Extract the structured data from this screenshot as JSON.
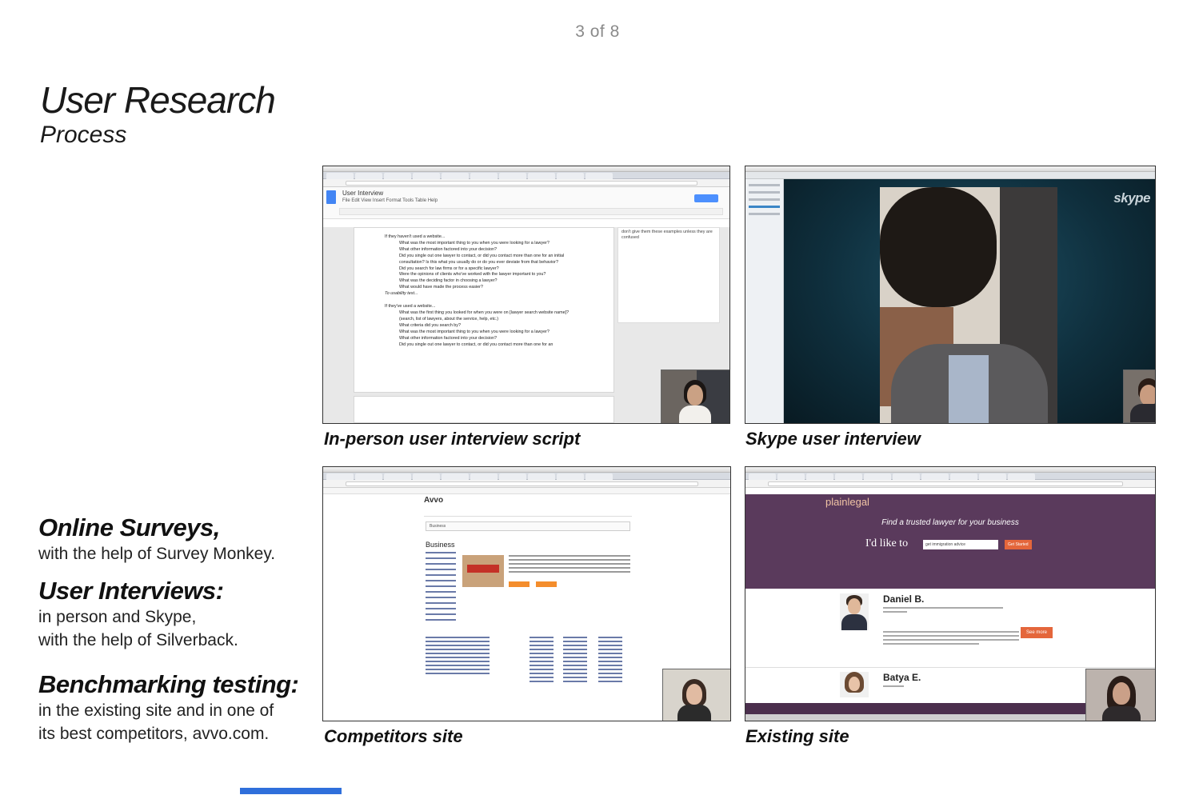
{
  "page_counter": "3 of 8",
  "title": "User Research",
  "subtitle": "Process",
  "methods": [
    {
      "heading": "Online Surveys,",
      "lines": [
        "with the help of Survey Monkey."
      ]
    },
    {
      "heading": "User Interviews:",
      "lines": [
        "in person and Skype,",
        "with the help of Silverback."
      ]
    },
    {
      "heading": "Benchmarking testing:",
      "lines": [
        "in the existing site and in one of",
        "its best competitors, avvo.com."
      ]
    }
  ],
  "screenshots": {
    "docs": {
      "caption": "In-person user interview script",
      "doc_title": "User Interview",
      "menu": "File   Edit   View   Insert   Format   Tools   Table   Help",
      "comment": "don't give them these examples unless they are confused",
      "lines": [
        "If they haven't used a website...",
        "What was the most important thing to you when you were looking for a lawyer?",
        "What other information factored into your decision?",
        "Did you single out one lawyer to contact, or did you contact more than one for an initial consultation? Is this what you usually do or do you ever deviate from that behavior?",
        "Did you search for law firms or for a specific lawyer?",
        "Were the opinions of clients who've worked with the lawyer important to you?",
        "What was the deciding factor in choosing a lawyer?",
        "What would have made the process easier?",
        "To usability test...",
        "If they've used a website...",
        "What was the first thing you looked for when you were on [lawyer search website name]? (search, list of lawyers, about the service, help, etc.)",
        "What criteria did you search by?",
        "What was the most important thing to you when you were looking for a lawyer?",
        "What other information factored into your decision?",
        "Did you single out one lawyer to contact, or did you contact more than one for an"
      ]
    },
    "skype": {
      "caption": "Skype user interview",
      "logo": "skype"
    },
    "avvo": {
      "caption": "Competitors site",
      "logo": "Avvo",
      "search_value": "Business",
      "heading": "Business"
    },
    "plainlegal": {
      "caption": "Existing site",
      "logo": "plainlegal",
      "tagline": "Find a trusted lawyer for your business",
      "prompt": "I'd like to",
      "input_value": "get immigration advice",
      "go": "Get Started",
      "lawyer1": "Daniel B.",
      "lawyer2": "Batya E.",
      "see_more": "See more"
    }
  },
  "colors": {
    "progress": "#2f6fdb",
    "plainlegal_purple": "#5a3a5c",
    "accent_orange": "#e4663b"
  }
}
